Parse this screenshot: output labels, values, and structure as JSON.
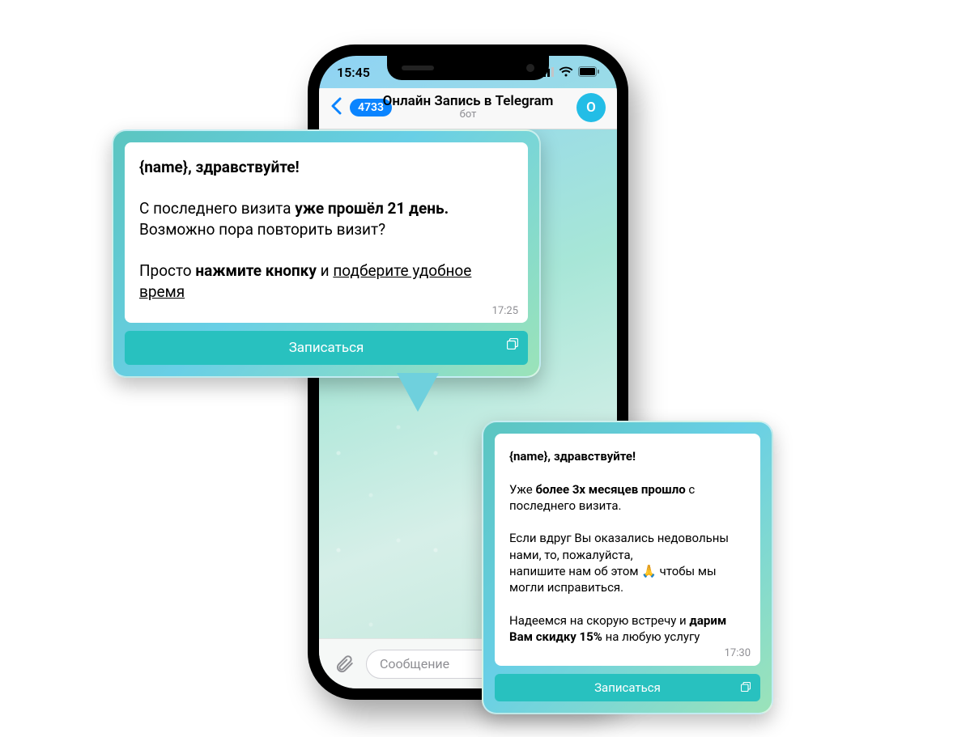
{
  "statusbar": {
    "time": "15:45"
  },
  "header": {
    "back_badge": "4733",
    "title": "Онлайн Запись в Telegram",
    "subtitle": "бот",
    "avatar_letter": "O"
  },
  "input": {
    "placeholder": "Сообщение"
  },
  "card1": {
    "greeting_pre": "{name}",
    "greeting_post": ", здравствуйте!",
    "l1": "С последнего визита ",
    "l1b": "уже прошёл 21 день.",
    "l2": "Возможно пора повторить визит?",
    "l3": "Просто ",
    "l3b": "нажмите кнопку",
    "l3c": " и ",
    "l3u": "подберите удобное время",
    "time": "17:25",
    "button": "Записаться"
  },
  "card2": {
    "greeting_pre": "{name}",
    "greeting_post": ", здравствуйте!",
    "p1a": "Уже ",
    "p1b": "более 3х месяцев прошло",
    "p1c": " с последнего визита.",
    "p2": "Если вдруг Вы оказались недовольны нами, то, пожалуйста,",
    "p2b": "напишите нам об этом 🙏 чтобы мы могли исправиться.",
    "p3a": "Надеемся на скорую встречу и ",
    "p3b": "дарим Вам скидку 15%",
    "p3c": " на любую услугу",
    "time": "17:30",
    "button": "Записаться"
  }
}
